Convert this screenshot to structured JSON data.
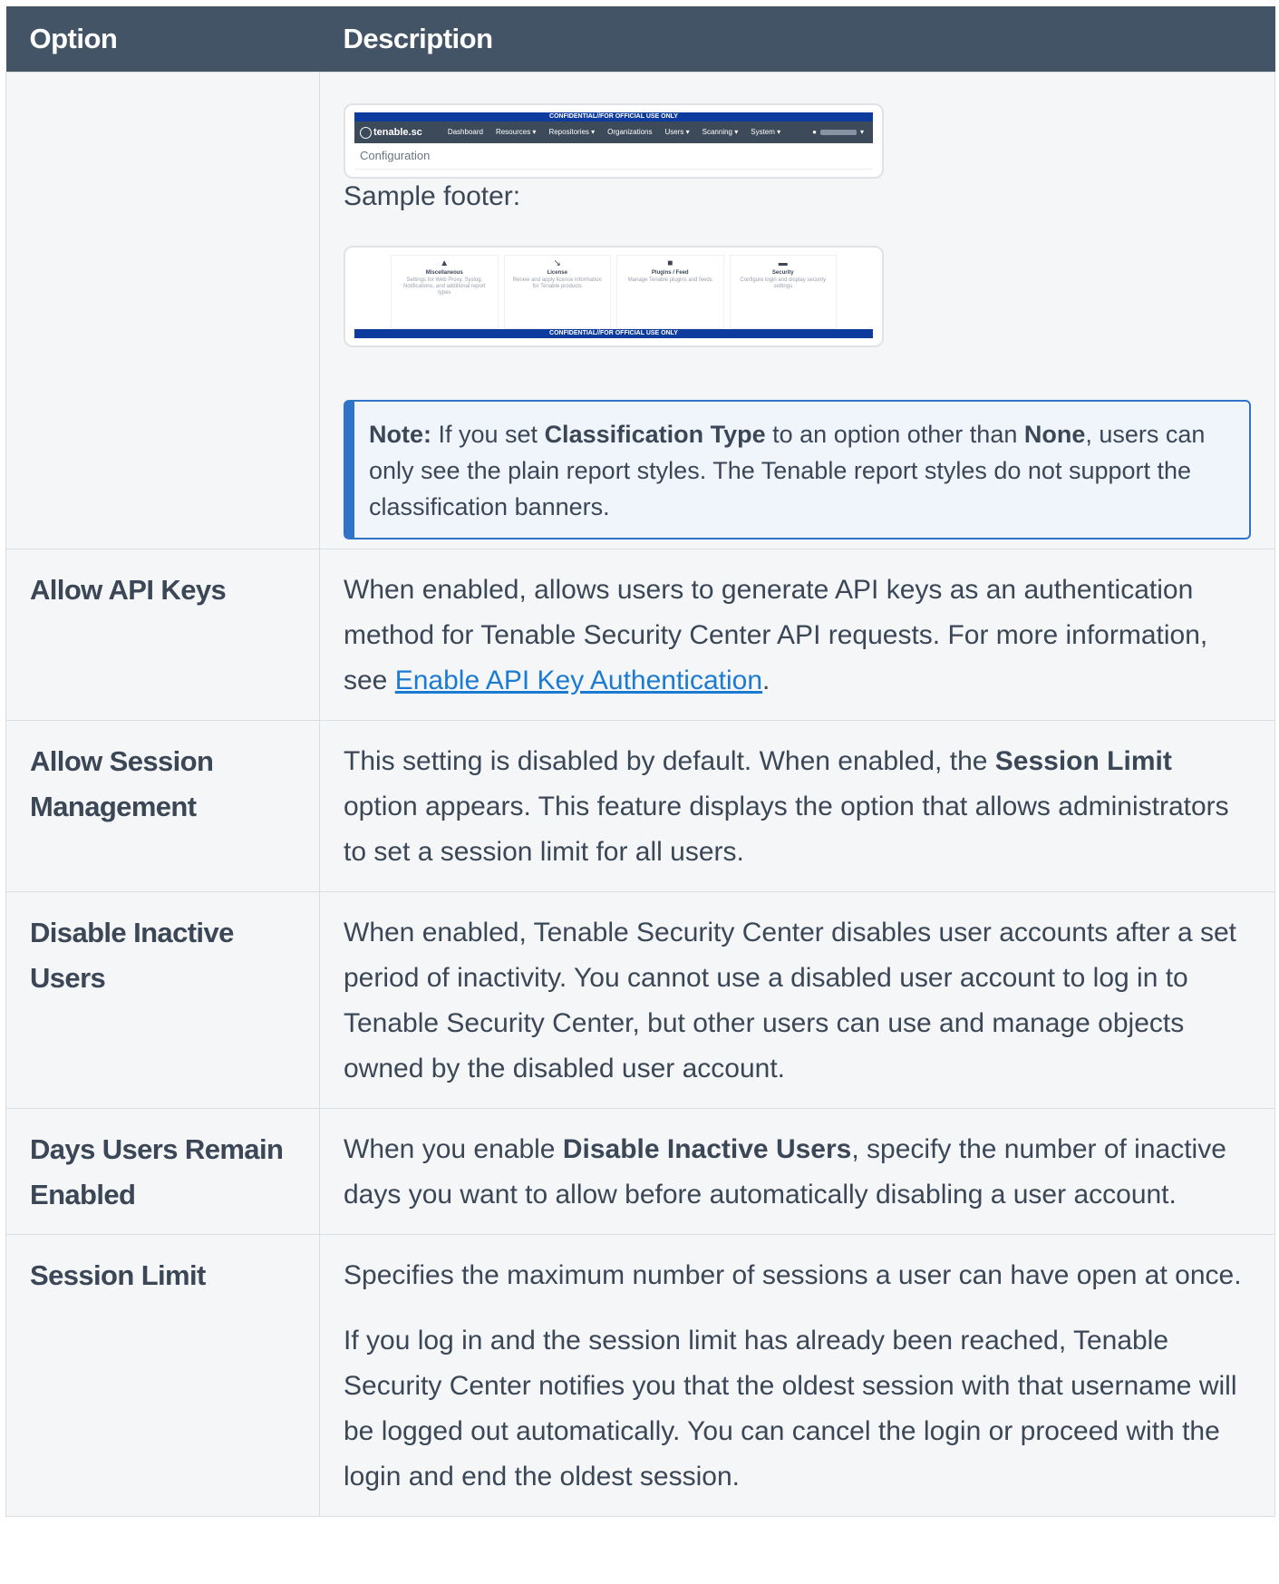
{
  "table": {
    "headers": {
      "option": "Option",
      "description": "Description"
    }
  },
  "sample_header_shot": {
    "banner": "CONFIDENTIAL//FOR OFFICIAL USE ONLY",
    "logo": "tenable.sc",
    "nav": [
      "Dashboard",
      "Resources ▾",
      "Repositories ▾",
      "Organizations",
      "Users ▾",
      "Scanning ▾",
      "System ▾"
    ],
    "page_title": "Configuration"
  },
  "sample_footer": {
    "caption": "Sample footer:",
    "tiles": [
      {
        "title": "Miscellaneous",
        "desc": "Settings for Web Proxy, Syslog, Notifications, and additional report types"
      },
      {
        "title": "License",
        "desc": "Renew and apply license information for Tenable products"
      },
      {
        "title": "Plugins / Feed",
        "desc": "Manage Tenable plugins and feeds"
      },
      {
        "title": "Security",
        "desc": "Configure login and display security settings"
      }
    ],
    "banner": "CONFIDENTIAL//FOR OFFICIAL USE ONLY"
  },
  "note": {
    "label": "Note:",
    "t1": " If you set ",
    "b1": "Classification Type",
    "t2": " to an option other than ",
    "b2": "None",
    "t3": ", users can only see the plain report styles. The Tenable report styles do not support the classification banners."
  },
  "rows": {
    "api_keys": {
      "option": "Allow API Keys",
      "t1": "When enabled, allows users to generate API keys as an authentication method for Tenable Security Center API requests. For more information, see ",
      "link": "Enable API Key Authentication",
      "t2": "."
    },
    "session_mgmt": {
      "option": "Allow Session Management",
      "t1": "This setting is disabled by default. When enabled, the ",
      "b1": "Session Limit",
      "t2": " option appears. This feature displays the option that allows administrators to set a session limit for all users."
    },
    "disable_inactive": {
      "option": "Disable Inactive Users",
      "text": "When enabled, Tenable Security Center disables user accounts after a set period of inactivity. You cannot use a disabled user account to log in to Tenable Security Center, but other users can use and manage objects owned by the disabled user account."
    },
    "days_enabled": {
      "option": "Days Users Remain Enabled",
      "t1": "When you enable ",
      "b1": "Disable Inactive Users",
      "t2": ", specify the number of inactive days you want to allow before automatically disabling a user account."
    },
    "session_limit": {
      "option": "Session Limit",
      "p1": "Specifies the maximum number of sessions a user can have open at once.",
      "p2": "If you log in and the session limit has already been reached, Tenable Security Center notifies you that the oldest session with that username will be logged out automatically. You can cancel the login or proceed with the login and end the oldest session."
    }
  }
}
